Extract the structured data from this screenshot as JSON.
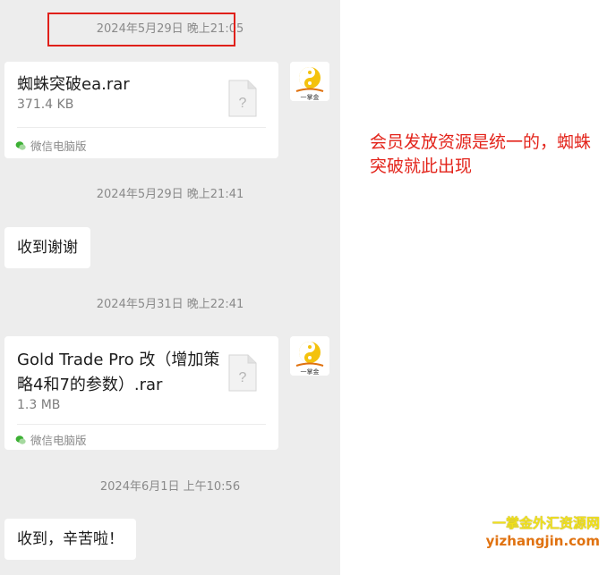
{
  "messages": [
    {
      "timestamp": "2024年5月29日 晚上21:05"
    },
    {
      "file_name": "蜘蛛突破ea.rar",
      "file_size": "371.4 KB",
      "source": "微信电脑版"
    },
    {
      "timestamp": "2024年5月29日 晚上21:41"
    },
    {
      "text": "收到谢谢"
    },
    {
      "timestamp": "2024年5月31日 晚上22:41"
    },
    {
      "file_name": "Gold Trade Pro 改（增加策略4和7的参数）.rar",
      "file_size": "1.3 MB",
      "source": "微信电脑版"
    },
    {
      "timestamp": "2024年6月1日 上午10:56"
    },
    {
      "text": "收到，辛苦啦！"
    }
  ],
  "annotation": {
    "note": "会员发放资源是统一的，蜘蛛突破就此出现",
    "highlight_color": "#e0201a"
  },
  "avatar": {
    "label": "一掌金"
  },
  "watermark": {
    "line1": "一掌金外汇资源网",
    "line2": "yizhangjin.com"
  },
  "colors": {
    "chat_bg": "#ededed",
    "bubble_bg": "#ffffff",
    "note_text": "#e3241b"
  }
}
